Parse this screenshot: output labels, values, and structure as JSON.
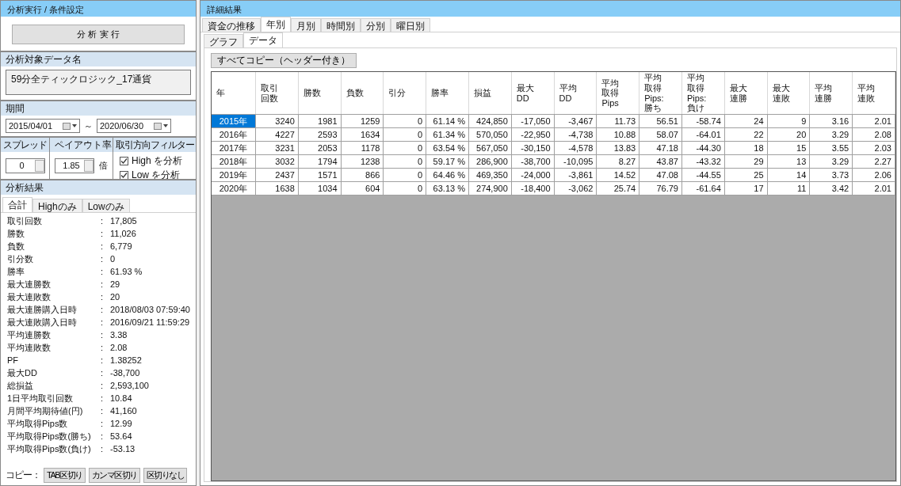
{
  "left": {
    "title": "分析実行 / 条件設定",
    "run_button": "分 析 実 行",
    "data_name": {
      "label": "分析対象データ名",
      "value": "59分全ティックロジック_17通貨"
    },
    "period": {
      "label": "期間",
      "from": "2015/04/01",
      "separator": "～",
      "to": "2020/06/30"
    },
    "spread": {
      "label": "スプレッド",
      "value": "0"
    },
    "payout": {
      "label": "ペイアウト率",
      "value": "1.85",
      "unit": "倍"
    },
    "filter": {
      "label": "取引方向フィルター",
      "options": [
        {
          "label": "High を分析",
          "checked": true
        },
        {
          "label": "Low を分析",
          "checked": true
        }
      ]
    },
    "results": {
      "title": "分析結果",
      "tabs": [
        {
          "label": "合計",
          "selected": true
        },
        {
          "label": "Highのみ",
          "selected": false
        },
        {
          "label": "Lowのみ",
          "selected": false
        }
      ],
      "separator": ":",
      "rows": [
        {
          "label": "取引回数",
          "value": "17,805"
        },
        {
          "label": "勝数",
          "value": "11,026"
        },
        {
          "label": "負数",
          "value": "6,779"
        },
        {
          "label": "引分数",
          "value": "0"
        },
        {
          "label": "勝率",
          "value": "61.93 %"
        },
        {
          "label": "最大連勝数",
          "value": "29"
        },
        {
          "label": "最大連敗数",
          "value": "20"
        },
        {
          "label": "最大連勝購入日時",
          "value": "2018/08/03 07:59:40"
        },
        {
          "label": "最大連敗購入日時",
          "value": "2016/09/21 11:59:29"
        },
        {
          "label": "平均連勝数",
          "value": "3.38"
        },
        {
          "label": "平均連敗数",
          "value": "2.08"
        },
        {
          "label": "PF",
          "value": "1.38252"
        },
        {
          "label": "最大DD",
          "value": "-38,700"
        },
        {
          "label": "総損益",
          "value": "2,593,100"
        },
        {
          "label": "1日平均取引回数",
          "value": "10.84"
        },
        {
          "label": "月間平均期待値(円)",
          "value": "41,160"
        },
        {
          "label": "平均取得Pips数",
          "value": "12.99"
        },
        {
          "label": "平均取得Pips数(勝ち)",
          "value": "53.64"
        },
        {
          "label": "平均取得Pips数(負け)",
          "value": "-53.13"
        }
      ],
      "copy_label": "コピー：",
      "copy_buttons": [
        "TAB区切り",
        "カンマ区切り",
        "区切りなし"
      ]
    }
  },
  "right": {
    "title": "詳細結果",
    "tabs": [
      {
        "label": "資金の推移",
        "selected": false
      },
      {
        "label": "年別",
        "selected": true
      },
      {
        "label": "月別",
        "selected": false
      },
      {
        "label": "時間別",
        "selected": false
      },
      {
        "label": "分別",
        "selected": false
      },
      {
        "label": "曜日別",
        "selected": false
      }
    ],
    "subtabs": [
      {
        "label": "グラフ",
        "selected": false
      },
      {
        "label": "データ",
        "selected": true
      }
    ],
    "copy_all_button": "すべてコピー（ヘッダー付き）",
    "table": {
      "columns": [
        "年",
        "取引回数",
        "勝数",
        "負数",
        "引分",
        "勝率",
        "損益",
        "最大DD",
        "平均DD",
        "平均取得Pips",
        "平均取得Pips:勝ち",
        "平均取得Pips:負け",
        "最大連勝",
        "最大連敗",
        "平均連勝",
        "平均連敗"
      ],
      "rows": [
        {
          "selected": true,
          "cells": [
            "2015年",
            "3240",
            "1981",
            "1259",
            "0",
            "61.14 %",
            "424,850",
            "-17,050",
            "-3,467",
            "11.73",
            "56.51",
            "-58.74",
            "24",
            "9",
            "3.16",
            "2.01"
          ]
        },
        {
          "selected": false,
          "cells": [
            "2016年",
            "4227",
            "2593",
            "1634",
            "0",
            "61.34 %",
            "570,050",
            "-22,950",
            "-4,738",
            "10.88",
            "58.07",
            "-64.01",
            "22",
            "20",
            "3.29",
            "2.08"
          ]
        },
        {
          "selected": false,
          "cells": [
            "2017年",
            "3231",
            "2053",
            "1178",
            "0",
            "63.54 %",
            "567,050",
            "-30,150",
            "-4,578",
            "13.83",
            "47.18",
            "-44.30",
            "18",
            "15",
            "3.55",
            "2.03"
          ]
        },
        {
          "selected": false,
          "cells": [
            "2018年",
            "3032",
            "1794",
            "1238",
            "0",
            "59.17 %",
            "286,900",
            "-38,700",
            "-10,095",
            "8.27",
            "43.87",
            "-43.32",
            "29",
            "13",
            "3.29",
            "2.27"
          ]
        },
        {
          "selected": false,
          "cells": [
            "2019年",
            "2437",
            "1571",
            "866",
            "0",
            "64.46 %",
            "469,350",
            "-24,000",
            "-3,861",
            "14.52",
            "47.08",
            "-44.55",
            "25",
            "14",
            "3.73",
            "2.06"
          ]
        },
        {
          "selected": false,
          "cells": [
            "2020年",
            "1638",
            "1034",
            "604",
            "0",
            "63.13 %",
            "274,900",
            "-18,400",
            "-3,062",
            "25.74",
            "76.79",
            "-61.64",
            "17",
            "11",
            "3.42",
            "2.01"
          ]
        }
      ]
    }
  }
}
